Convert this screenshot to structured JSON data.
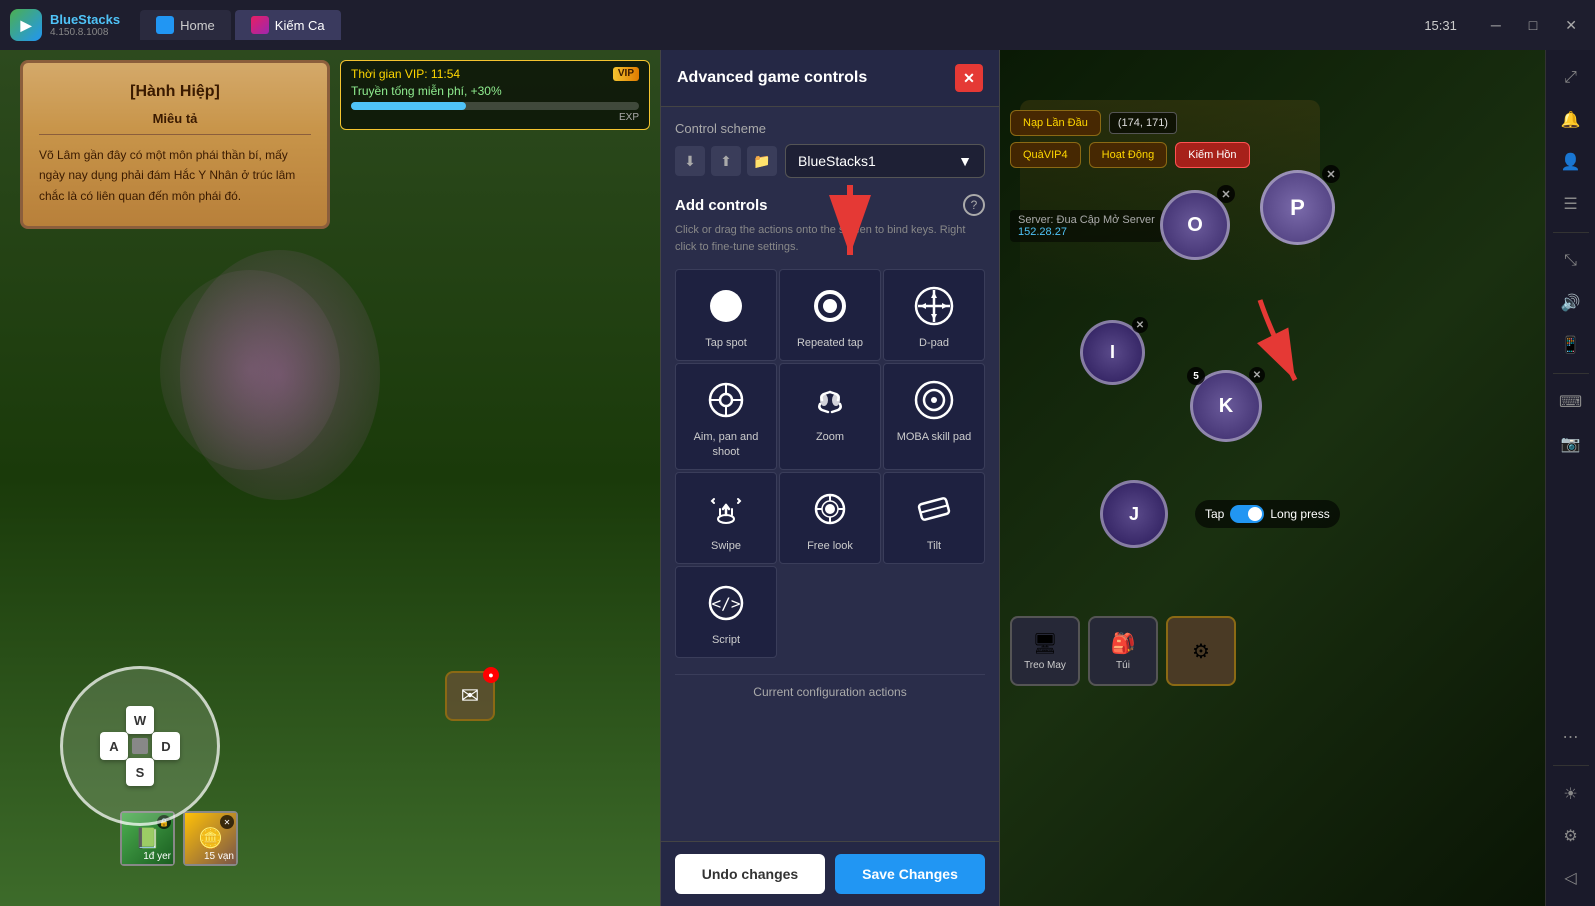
{
  "app": {
    "name": "BlueStacks",
    "version": "4.150.8.1008"
  },
  "titlebar": {
    "tabs": [
      {
        "id": "home",
        "label": "Home",
        "active": false
      },
      {
        "id": "game",
        "label": "Kiếm Ca",
        "active": true
      }
    ],
    "time": "15:31",
    "window_controls": [
      "minimize",
      "maximize",
      "close"
    ]
  },
  "game_panel": {
    "scroll_title": "[Hành Hiệp]",
    "mieutа": "Miêu tả",
    "scroll_body": "Võ Lâm gần đây có một môn phái thần bí, mấy ngày nay dụng phải đám Hắc Y Nhân ở trúc lâm chắc là có liên quan đến môn phái đó.",
    "vip_time": "Thời gian VIP: 11:54",
    "vip_truyen": "Truyền tống miễn phí, +30%",
    "exp_label": "EXP"
  },
  "wasd": {
    "w": "W",
    "a": "A",
    "s": "S",
    "d": "D"
  },
  "controls_panel": {
    "title": "Advanced game controls",
    "control_scheme_label": "Control scheme",
    "scheme_name": "BlueStacks1",
    "add_controls_title": "Add controls",
    "add_controls_desc": "Click or drag the actions onto the screen to bind keys. Right click to fine-tune settings.",
    "controls": [
      {
        "id": "tap_spot",
        "label": "Tap spot"
      },
      {
        "id": "repeated_tap",
        "label": "Repeated tap"
      },
      {
        "id": "d_pad",
        "label": "D-pad"
      },
      {
        "id": "aim_pan_shoot",
        "label": "Aim, pan and shoot"
      },
      {
        "id": "zoom",
        "label": "Zoom"
      },
      {
        "id": "moba_skill_pad",
        "label": "MOBA skill pad"
      },
      {
        "id": "swipe",
        "label": "Swipe"
      },
      {
        "id": "free_look",
        "label": "Free look"
      },
      {
        "id": "tilt",
        "label": "Tilt"
      },
      {
        "id": "script",
        "label": "Script"
      }
    ],
    "current_config_label": "Current configuration actions",
    "footer": {
      "undo_label": "Undo changes",
      "save_label": "Save Changes"
    }
  },
  "skill_buttons": [
    {
      "key": "O",
      "label": "O"
    },
    {
      "key": "P",
      "label": "P"
    },
    {
      "key": "I",
      "label": "I"
    },
    {
      "key": "K",
      "label": "K"
    },
    {
      "key": "J",
      "label": "J"
    }
  ],
  "tap_toggle": {
    "tap_label": "Tap",
    "long_press_label": "Long press"
  },
  "right_sidebar": {
    "icons": [
      "bell",
      "user",
      "menu",
      "settings"
    ]
  }
}
